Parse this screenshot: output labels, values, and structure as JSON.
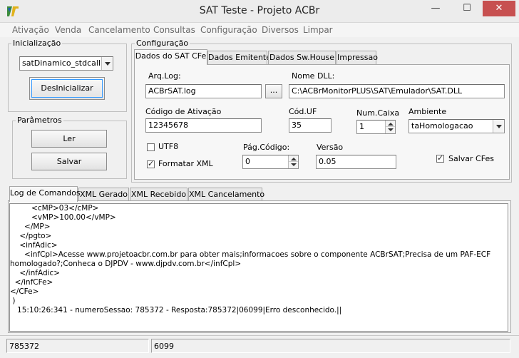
{
  "window": {
    "title": "SAT Teste - Projeto ACBr",
    "minimize": "—",
    "maximize": "☐",
    "close": "✕"
  },
  "menu": [
    "Ativação",
    "Venda",
    "Cancelamento",
    "Consultas",
    "Configuração",
    "Diversos",
    "Limpar"
  ],
  "inicializacao": {
    "title": "Inicialização",
    "lib_value": "satDinamico_stdcall",
    "button": "DesInicializar"
  },
  "parametros": {
    "title": "Parâmetros",
    "ler": "Ler",
    "salvar": "Salvar"
  },
  "configuracao": {
    "title": "Configuração",
    "tabs": [
      "Dados do SAT CFe",
      "Dados Emitente",
      "Dados Sw.House",
      "Impressao"
    ],
    "arq_log_label": "Arq.Log:",
    "arq_log_value": "ACBrSAT.log",
    "browse_label": "...",
    "nome_dll_label": "Nome DLL:",
    "nome_dll_value": "C:\\ACBrMonitorPLUS\\SAT\\Emulador\\SAT.DLL",
    "codigo_ativacao_label": "Código de Ativação",
    "codigo_ativacao_value": "12345678",
    "cod_uf_label": "Cód.UF",
    "cod_uf_value": "35",
    "num_caixa_label": "Num.Caixa",
    "num_caixa_value": "1",
    "ambiente_label": "Ambiente",
    "ambiente_value": "taHomologacao",
    "utf8_label": "UTF8",
    "formatar_xml_label": "Formatar XML",
    "pag_codigo_label": "Pág.Código:",
    "pag_codigo_value": "0",
    "versao_label": "Versão",
    "versao_value": "0.05",
    "salvar_cfes_label": "Salvar CFes"
  },
  "log_tabs": [
    "Log de Comandos",
    "XML Gerado",
    "XML Recebido",
    "XML Cancelamento"
  ],
  "log_lines": [
    "         <cMP>03</cMP>",
    "         <vMP>100.00</vMP>",
    "      </MP>",
    "    </pgto>",
    "    <infAdic>",
    "      <infCpl>Acesse www.projetoacbr.com.br para obter mais;informacoes sobre o componente ACBrSAT;Precisa de um PAF-ECF",
    "homologado?;Conheca o DJPDV - www.djpdv.com.br</infCpl>",
    "    </infAdic>",
    "  </infCFe>",
    "</CFe>",
    " )",
    "   15:10:26:341 - numeroSessao: 785372 - Resposta:785372|06099|Erro desconhecido.||"
  ],
  "status": {
    "sessao": "785372",
    "codigo": "6099"
  }
}
